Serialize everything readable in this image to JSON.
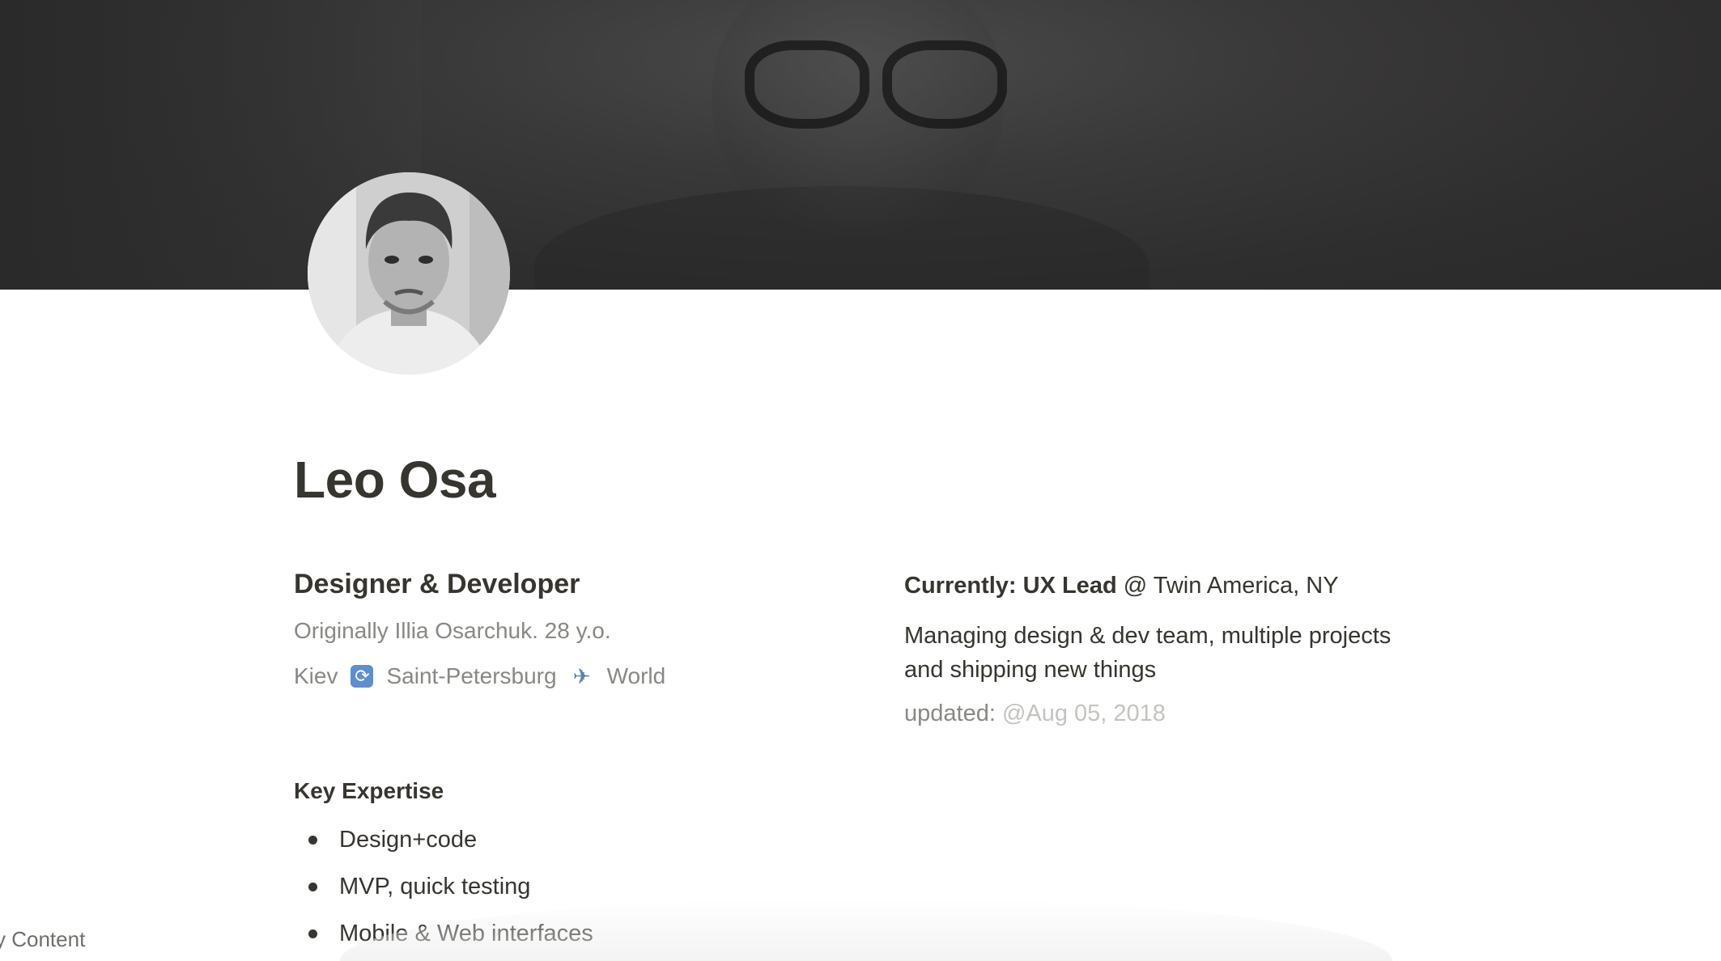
{
  "page": {
    "title": "Leo Osa"
  },
  "profile": {
    "role": "Designer & Developer",
    "origin": "Originally Illia Osarchuk. 28 y.o.",
    "route": {
      "from": "Kiev",
      "via": "Saint-Petersburg",
      "to": "World",
      "icons": [
        "cycle-arrows-icon",
        "airplane-icon"
      ]
    }
  },
  "expertise": {
    "heading": "Key Expertise",
    "items": [
      "Design+code",
      "MVP, quick testing",
      "Mobile & Web interfaces"
    ]
  },
  "current": {
    "label": "Currently: UX Lead",
    "at": "@ Twin America, NY",
    "description": "Managing design & dev team, multiple projects and shipping new things",
    "updated_label": "updated:",
    "updated_date": "@Aug 05, 2018"
  },
  "sidebar": {
    "toc_fragment": "y Content"
  },
  "colors": {
    "text": "#37352f",
    "muted": "#8a8884",
    "faint": "#c4c3c0",
    "cover": "#333232"
  }
}
